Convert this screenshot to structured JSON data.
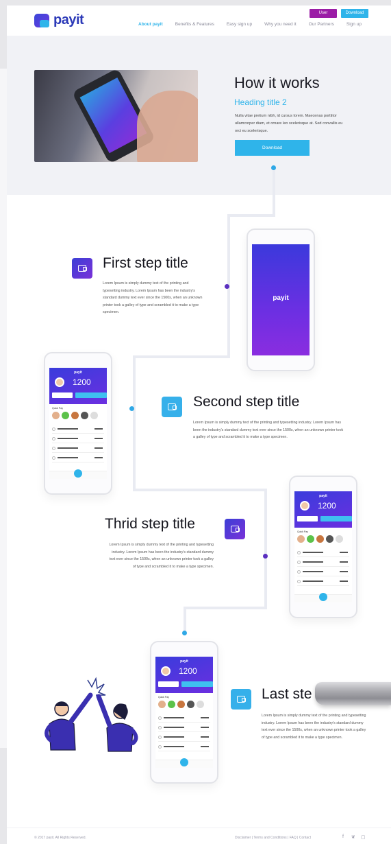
{
  "header": {
    "logo_text": "payit",
    "nav": [
      "About payit",
      "Benefits & Features",
      "Easy sign up",
      "Why you need it",
      "Our Partners",
      "Sign up"
    ],
    "user_button": "User",
    "download_button": "Download"
  },
  "hero": {
    "title": "How it works",
    "subtitle": "Heading title 2",
    "text": "Nulla vitae pretium nibh, id cursus lorem. Maecenas porttitor ullamcorper diam, et ornare leo scelerisque at. Sed convallis eu orci eu scelerisque.",
    "button": "Download"
  },
  "steps": [
    {
      "title": "First step title",
      "text": "Lorem Ipsum is simply dummy text of the printing and typesetting industry. Lorem Ipsum has been the industry's standard dummy text ever since the 1500s, when an unknown printer took a galley of type and scrambled it to make a type specimen."
    },
    {
      "title": "Second step title",
      "text": "Lorem Ipsum is simply dummy text of the printing and typesetting industry. Lorem Ipsum has been the industry's standard dummy text ever since the 1500s, when an unknown printer took a galley of type and scrambled it to make a type specimen."
    },
    {
      "title": "Thrid step title",
      "text": "Lorem Ipsum is simply dummy text of the printing and typesetting industry. Lorem Ipsum has been the industry's standard dummy text ever since the 1500s, when an unknown printer took a galley of type and scrambled it to make a type specimen."
    },
    {
      "title": "Last ste",
      "text": "Lorem Ipsum is simply dummy text of the printing and typesetting industry. Lorem Ipsum has been the industry's standard dummy text ever since the 1500s, when an unknown printer took a galley of type and scrambled it to make a type specimen."
    }
  ],
  "app": {
    "splash_logo": "payit",
    "brand": "payit",
    "balance": "1200",
    "quick_pay": "Quick Pay"
  },
  "footer": {
    "copyright": "© 2017 payit. All Rights Reserved.",
    "links": "Disclaimer  |  Terms and Conditions  |  FAQ  |  Contact",
    "social_icons": [
      "facebook-icon",
      "twitter-icon",
      "instagram-icon"
    ]
  },
  "colors": {
    "brand_blue": "#2c3ab8",
    "accent_cyan": "#2fb4ea",
    "accent_purple": "#6b2fe0",
    "user_button": "#9b1da6"
  }
}
